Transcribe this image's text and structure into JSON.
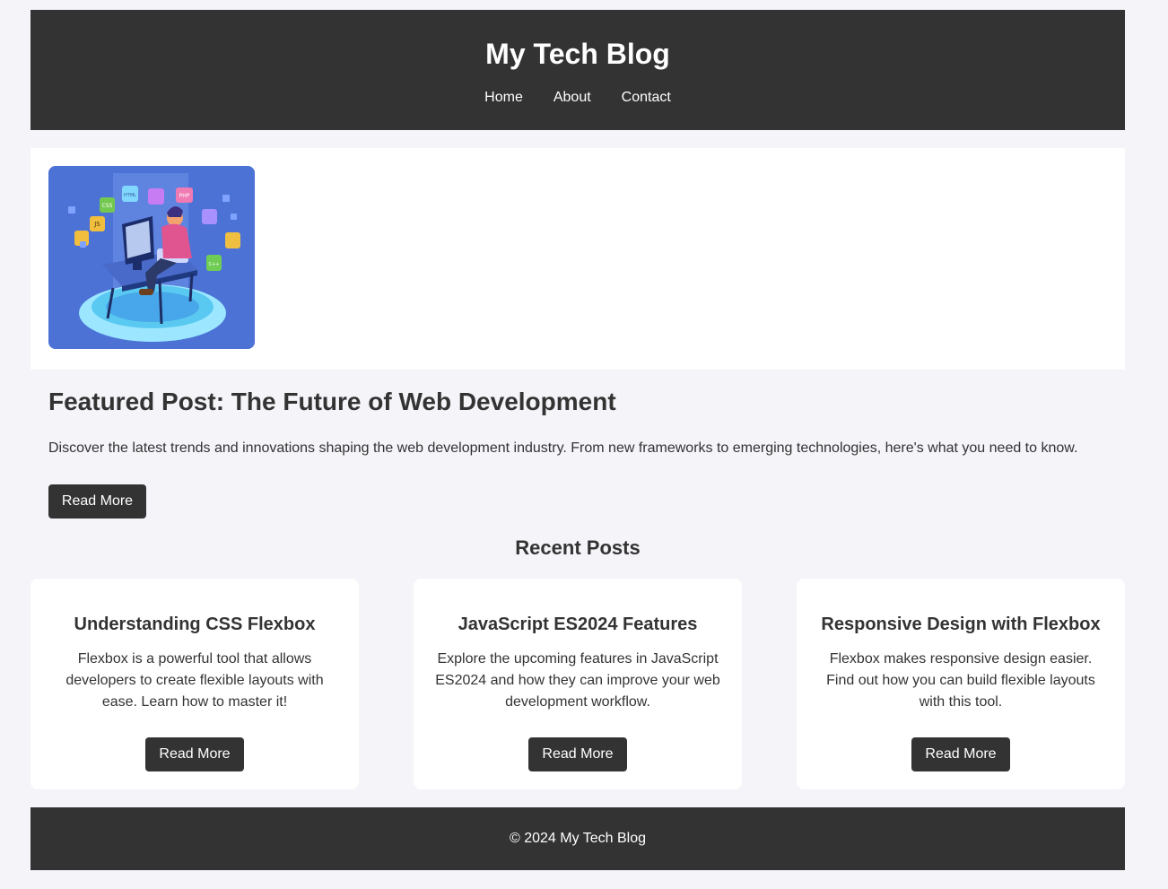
{
  "header": {
    "title": "My Tech Blog",
    "nav": [
      {
        "label": "Home"
      },
      {
        "label": "About"
      },
      {
        "label": "Contact"
      }
    ]
  },
  "featured": {
    "title": "Featured Post: The Future of Web Development",
    "excerpt": "Discover the latest trends and innovations shaping the web development industry. From new frameworks to emerging technologies, here's what you need to know.",
    "button_label": "Read More",
    "image_icon": "developer-workstation-illustration",
    "image_badges": [
      "CSS",
      "HTML",
      "JS",
      "PHP",
      "C++"
    ]
  },
  "recent": {
    "heading": "Recent Posts",
    "posts": [
      {
        "title": "Understanding CSS Flexbox",
        "excerpt": "Flexbox is a powerful tool that allows developers to create flexible layouts with ease. Learn how to master it!",
        "button_label": "Read More"
      },
      {
        "title": "JavaScript ES2024 Features",
        "excerpt": "Explore the upcoming features in JavaScript ES2024 and how they can improve your web development workflow.",
        "button_label": "Read More"
      },
      {
        "title": "Responsive Design with Flexbox",
        "excerpt": "Flexbox makes responsive design easier. Find out how you can build flexible layouts with this tool.",
        "button_label": "Read More"
      }
    ]
  },
  "footer": {
    "text": "© 2024 My Tech Blog"
  },
  "colors": {
    "page_background": "#f4f4f9",
    "dark": "#333333",
    "card_background": "#ffffff",
    "hero_blue": "#4c72d6"
  }
}
